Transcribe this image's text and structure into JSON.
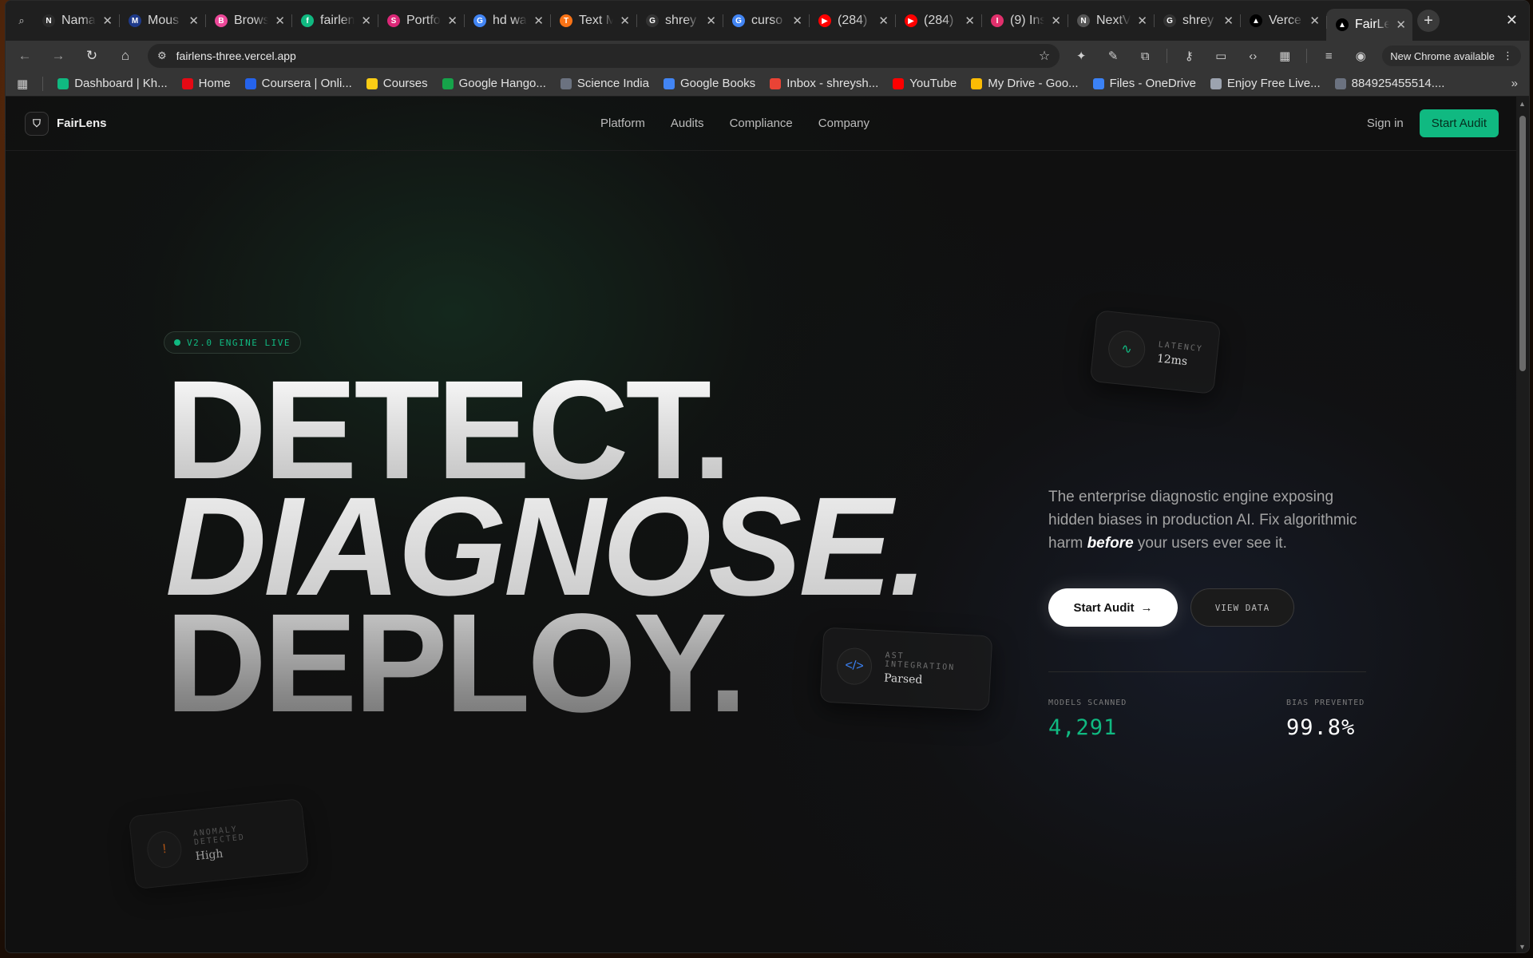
{
  "browser": {
    "tabs": [
      {
        "title": "Nama",
        "icon": "N",
        "color": "#2b2b2b"
      },
      {
        "title": "Mous",
        "icon": "M",
        "color": "#1e3a8a"
      },
      {
        "title": "Brows",
        "icon": "B",
        "color": "#ec4899"
      },
      {
        "title": "fairlen",
        "icon": "f",
        "color": "#10b981"
      },
      {
        "title": "Portfo",
        "icon": "S",
        "color": "#db2777"
      },
      {
        "title": "hd wa",
        "icon": "G",
        "color": "#4285f4"
      },
      {
        "title": "Text M",
        "icon": "T",
        "color": "#f97316"
      },
      {
        "title": "shrey",
        "icon": "G",
        "color": "#333333"
      },
      {
        "title": "curso",
        "icon": "G",
        "color": "#4285f4"
      },
      {
        "title": "(284)",
        "icon": "▶",
        "color": "#ff0000"
      },
      {
        "title": "(284)",
        "icon": "▶",
        "color": "#ff0000"
      },
      {
        "title": "(9) Ins",
        "icon": "I",
        "color": "#e1306c"
      },
      {
        "title": "NextV",
        "icon": "N",
        "color": "#555555"
      },
      {
        "title": "shrey",
        "icon": "G",
        "color": "#333333"
      },
      {
        "title": "Verce",
        "icon": "▲",
        "color": "#000000"
      },
      {
        "title": "FairLe",
        "icon": "▲",
        "color": "#000000"
      }
    ],
    "url": "fairlens-three.vercel.app",
    "update_label": "New Chrome available",
    "bookmarks": [
      {
        "label": "Dashboard | Kh...",
        "color": "#10b981"
      },
      {
        "label": "Home",
        "color": "#e50914"
      },
      {
        "label": "Coursera | Onli...",
        "color": "#2563eb"
      },
      {
        "label": "Courses",
        "color": "#facc15"
      },
      {
        "label": "Google Hango...",
        "color": "#16a34a"
      },
      {
        "label": "Science India",
        "color": "#6b7280"
      },
      {
        "label": "Google Books",
        "color": "#4285f4"
      },
      {
        "label": "Inbox - shreysh...",
        "color": "#ea4335"
      },
      {
        "label": "YouTube",
        "color": "#ff0000"
      },
      {
        "label": "My Drive - Goo...",
        "color": "#fbbc04"
      },
      {
        "label": "Files - OneDrive",
        "color": "#3b82f6"
      },
      {
        "label": "Enjoy Free Live...",
        "color": "#9ca3af"
      },
      {
        "label": "884925455514....",
        "color": "#6b7280"
      }
    ]
  },
  "site": {
    "brand": "FairLens",
    "menu": [
      "Platform",
      "Audits",
      "Compliance",
      "Company"
    ],
    "sign_in": "Sign in",
    "cta": "Start Audit",
    "badge": "V2.0 ENGINE LIVE",
    "headline": [
      "DETECT.",
      "DIAGNOSE.",
      "DEPLOY."
    ],
    "desc_part1": "The enterprise diagnostic engine exposing hidden biases in production AI. Fix algorithmic harm ",
    "desc_emph": "before",
    "desc_part2": " your users ever see it.",
    "primary_button": "Start Audit",
    "secondary_button": "VIEW DATA",
    "stats": [
      {
        "label": "MODELS SCANNED",
        "value": "4,291"
      },
      {
        "label": "BIAS PREVENTED",
        "value": "99.8%"
      }
    ],
    "cards": {
      "latency": {
        "label": "LATENCY",
        "value": "12ms"
      },
      "ast": {
        "label": "AST INTEGRATION",
        "value": "Parsed"
      },
      "anomaly": {
        "label": "ANOMALY DETECTED",
        "value": "High"
      }
    },
    "accent": "#10b981"
  }
}
